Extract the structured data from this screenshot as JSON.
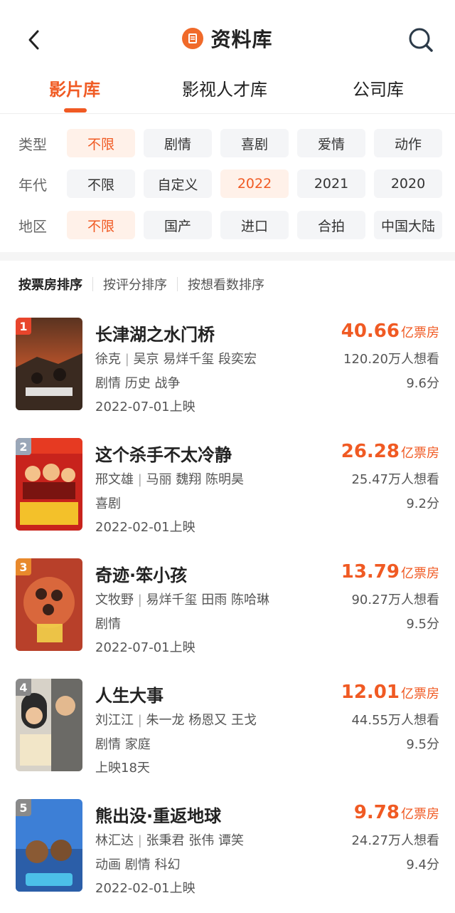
{
  "header": {
    "title": "资料库",
    "back_icon": "chevron-left-icon",
    "search_icon": "search-icon",
    "accent": "#f05a23"
  },
  "tabs": [
    {
      "label": "影片库",
      "active": true
    },
    {
      "label": "影视人才库",
      "active": false
    },
    {
      "label": "公司库",
      "active": false
    }
  ],
  "filters": {
    "type": {
      "label": "类型",
      "options": [
        "不限",
        "剧情",
        "喜剧",
        "爱情",
        "动作"
      ],
      "selected": "不限"
    },
    "year": {
      "label": "年代",
      "options": [
        "不限",
        "自定义",
        "2022",
        "2021",
        "2020"
      ],
      "selected": "2022"
    },
    "region": {
      "label": "地区",
      "options": [
        "不限",
        "国产",
        "进口",
        "合拍",
        "中国大陆"
      ],
      "selected": "不限"
    }
  },
  "sort": [
    {
      "label": "按票房排序",
      "active": true
    },
    {
      "label": "按评分排序",
      "active": false
    },
    {
      "label": "按想看数排序",
      "active": false
    }
  ],
  "movies": [
    {
      "rank": "1",
      "name": "长津湖之水门桥",
      "director": "徐克",
      "cast": "吴京 易烊千玺 段奕宏",
      "genre": "剧情 历史 战争",
      "date": "2022-07-01上映",
      "box": "40.66",
      "box_unit": "亿票房",
      "want": "120.20万人想看",
      "score": "9.6分",
      "rank_color": "#e8452c"
    },
    {
      "rank": "2",
      "name": "这个杀手不太冷静",
      "director": "邢文雄",
      "cast": "马丽 魏翔 陈明昊",
      "genre": "喜剧",
      "date": "2022-02-01上映",
      "box": "26.28",
      "box_unit": "亿票房",
      "want": "25.47万人想看",
      "score": "9.2分",
      "rank_color": "#9aa7b8"
    },
    {
      "rank": "3",
      "name": "奇迹·笨小孩",
      "director": "文牧野",
      "cast": "易烊千玺 田雨 陈哈琳",
      "genre": "剧情",
      "date": "2022-07-01上映",
      "box": "13.79",
      "box_unit": "亿票房",
      "want": "90.27万人想看",
      "score": "9.5分",
      "rank_color": "#e8892c"
    },
    {
      "rank": "4",
      "name": "人生大事",
      "director": "刘江江",
      "cast": "朱一龙 杨恩又 王戈",
      "genre": "剧情 家庭",
      "date": "上映18天",
      "box": "12.01",
      "box_unit": "亿票房",
      "want": "44.55万人想看",
      "score": "9.5分",
      "rank_color": "#8a8a8a"
    },
    {
      "rank": "5",
      "name": "熊出没·重返地球",
      "director": "林汇达",
      "cast": "张秉君 张伟 谭笑",
      "genre": "动画 剧情 科幻",
      "date": "2022-02-01上映",
      "box": "9.78",
      "box_unit": "亿票房",
      "want": "24.27万人想看",
      "score": "9.4分",
      "rank_color": "#8a8a8a"
    }
  ]
}
